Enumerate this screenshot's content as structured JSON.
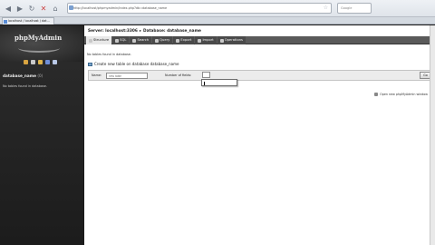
{
  "browser": {
    "tab_title": "localhost / localhost / dat...",
    "url": "http://localhost/phpmyadmin/index.php?db=database_name",
    "search_placeholder": "Google",
    "nav_icons": [
      "back-icon",
      "forward-icon",
      "reload-icon",
      "stop-icon",
      "home-icon"
    ]
  },
  "left_nav": {
    "logo_text": "phpMyAdmin",
    "db_name": "database_name",
    "db_count": "(0)",
    "no_tables": "No tables found in database.",
    "quick_icon_colors": [
      "#d9a441",
      "#c9c9c9",
      "#e0b64c",
      "#6f8fd8",
      "#b9c8e6"
    ]
  },
  "main": {
    "server_label": "Server: localhost:3306",
    "database_label": "Database: database_name",
    "tabs": [
      {
        "label": "Structure",
        "active": true
      },
      {
        "label": "SQL",
        "active": false
      },
      {
        "label": "Search",
        "active": false
      },
      {
        "label": "Query",
        "active": false
      },
      {
        "label": "Export",
        "active": false
      },
      {
        "label": "Import",
        "active": false
      },
      {
        "label": "Operations",
        "active": false
      }
    ],
    "notice": "No tables found in database.",
    "create_legend": "Create new table on database database_name",
    "name_label": "Name:",
    "name_value": "",
    "name_placeholder": "new table",
    "fields_label": "Number of fields:",
    "fields_value": "",
    "go_label": "Go",
    "open_window_label": "Open new phpMyAdmin window"
  }
}
